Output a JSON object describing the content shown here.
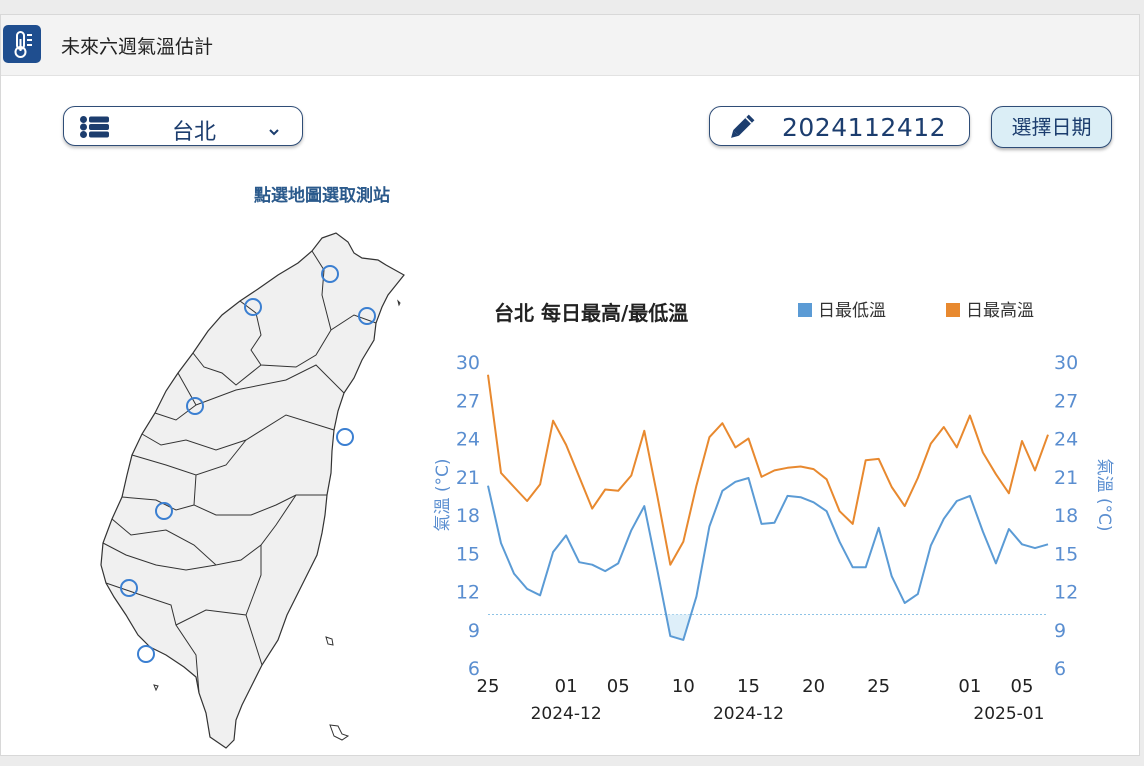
{
  "header": {
    "title": "未來六週氣溫估計",
    "icon": "thermometer-icon"
  },
  "station_select": {
    "value": "台北",
    "icon": "list-icon",
    "dropdown_icon": "chevron-down-icon"
  },
  "date_field": {
    "value": "2024112412",
    "icon": "pencil-icon"
  },
  "date_button": {
    "label": "選擇日期"
  },
  "map": {
    "hint": "點選地圖選取測站"
  },
  "colors": {
    "min_series": "#5b9bd5",
    "max_series": "#e8892f",
    "accent": "#1f4e8f",
    "axis_text": "#5a8ed0"
  },
  "chart_data": {
    "type": "line",
    "title": "台北 每日最高/最低溫",
    "ylabel": "氣溫 (°C)",
    "ylabel_right": "氣溫 (°C)",
    "ylim": [
      6,
      30
    ],
    "yticks": [
      30,
      27,
      24,
      21,
      18,
      15,
      12,
      9,
      6
    ],
    "reference_line": 10.2,
    "legend": {
      "placement": "top-right"
    },
    "x": [
      "2024-11-25",
      "2024-11-26",
      "2024-11-27",
      "2024-11-28",
      "2024-11-29",
      "2024-11-30",
      "2024-12-01",
      "2024-12-02",
      "2024-12-03",
      "2024-12-04",
      "2024-12-05",
      "2024-12-06",
      "2024-12-07",
      "2024-12-08",
      "2024-12-09",
      "2024-12-10",
      "2024-12-11",
      "2024-12-12",
      "2024-12-13",
      "2024-12-14",
      "2024-12-15",
      "2024-12-16",
      "2024-12-17",
      "2024-12-18",
      "2024-12-19",
      "2024-12-20",
      "2024-12-21",
      "2024-12-22",
      "2024-12-23",
      "2024-12-24",
      "2024-12-25",
      "2024-12-26",
      "2024-12-27",
      "2024-12-28",
      "2024-12-29",
      "2024-12-30",
      "2024-12-31",
      "2025-01-01",
      "2025-01-02",
      "2025-01-03",
      "2025-01-04",
      "2025-01-05",
      "2025-01-06",
      "2025-01-07"
    ],
    "xtick_labels": [
      {
        "x": "2024-11-25",
        "label": "25"
      },
      {
        "x": "2024-12-01",
        "label": "01"
      },
      {
        "x": "2024-12-05",
        "label": "05"
      },
      {
        "x": "2024-12-10",
        "label": "10"
      },
      {
        "x": "2024-12-15",
        "label": "15"
      },
      {
        "x": "2024-12-20",
        "label": "20"
      },
      {
        "x": "2024-12-25",
        "label": "25"
      },
      {
        "x": "2025-01-01",
        "label": "01"
      },
      {
        "x": "2025-01-05",
        "label": "05"
      }
    ],
    "month_labels": [
      {
        "x": "2024-12-01",
        "label": "2024-12"
      },
      {
        "x": "2024-12-15",
        "label": "2024-12"
      },
      {
        "x": "2025-01-04",
        "label": "2025-01"
      }
    ],
    "series": [
      {
        "name": "日最低溫",
        "values": [
          20.3,
          15.8,
          13.4,
          12.2,
          11.7,
          15.1,
          16.4,
          14.3,
          14.1,
          13.6,
          14.2,
          16.8,
          18.7,
          13.7,
          8.5,
          8.2,
          11.6,
          17.1,
          19.9,
          20.6,
          20.9,
          17.3,
          17.4,
          19.5,
          19.4,
          19.0,
          18.3,
          15.9,
          13.9,
          13.9,
          17.0,
          13.2,
          11.1,
          11.8,
          15.6,
          17.7,
          19.1,
          19.5,
          16.7,
          14.2,
          16.9,
          15.7,
          15.4,
          15.7
        ]
      },
      {
        "name": "日最高溫",
        "values": [
          29.0,
          21.3,
          20.2,
          19.1,
          20.4,
          25.4,
          23.5,
          21.0,
          18.5,
          20.0,
          19.9,
          21.1,
          24.6,
          19.5,
          14.1,
          15.9,
          20.3,
          24.1,
          25.2,
          23.3,
          24.0,
          21.0,
          21.5,
          21.7,
          21.8,
          21.6,
          20.8,
          18.3,
          17.3,
          22.3,
          22.4,
          20.2,
          18.7,
          20.9,
          23.6,
          24.9,
          23.3,
          25.8,
          22.9,
          21.2,
          19.7,
          23.8,
          21.5,
          24.3
        ]
      }
    ]
  }
}
